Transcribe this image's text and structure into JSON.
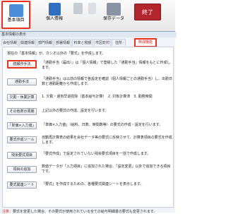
{
  "toolbar": {
    "basic": "基本項目",
    "personal": "個人情報",
    "shape": "",
    "tax": "",
    "save": "保存データ",
    "end": "終了"
  },
  "window": {
    "title": "基本情報の表示"
  },
  "tabs": [
    {
      "label": "会社情報"
    },
    {
      "label": "関連情報"
    },
    {
      "label": "部門情報"
    },
    {
      "label": "部署情報"
    },
    {
      "label": "料率と税額"
    },
    {
      "label": "市区町村"
    },
    {
      "label": "住所"
    },
    {
      "label": "既成機能",
      "active": true
    }
  ],
  "intro": "現在の「基本情報」が、カシオ以外の「要式」を作成します。",
  "rows": [
    {
      "button": "続報作手法",
      "text": "「通勤手当（届出）」は「個人情報」で登録した「通勤手当」情報をもとに作成します。",
      "highlight": true
    },
    {
      "button": "通勤手法",
      "text": "「通勤手当」は以前の情報で各設定を確認（個人情報ごとの通勤手当）し、出勤日数と通勤距離から作成します。"
    },
    {
      "button": "欠勤・休業計算",
      "text": "1. 欠勤・遅刻早退控除（基本給与計算）　2. 対象計算済　3. 勤務時間"
    },
    {
      "button": "その他表示周期",
      "text": "上記以外の要式の作成、設定を行います。"
    },
    {
      "button": "「単価×入力値」",
      "text": "「単価×入力値」（給料、日数、時間数等）の要式の作成・設定を行います。"
    },
    {
      "button": "要式作成ツール",
      "text": "自動再計算表の結果を会社データ等の要式に反映させて、計算表項目の要式を作成します。"
    },
    {
      "button": "残余要式項目",
      "text": "「要式作成」で設定されていない残余要式項目を一括で作成します。"
    },
    {
      "button": "項目の追加",
      "text": "数値データが「入力項目」に追加された場合、「設定変更」以外で追加できる項目です。"
    },
    {
      "button": "要式関連シート",
      "text": "「要式」を作成するための、各種要式関連シートを表示します。"
    }
  ],
  "note": {
    "prefix": "注意",
    "text": "：要式を変更した場合、その要式が使用されている全ての給与明細書の要式も変更されます。"
  }
}
